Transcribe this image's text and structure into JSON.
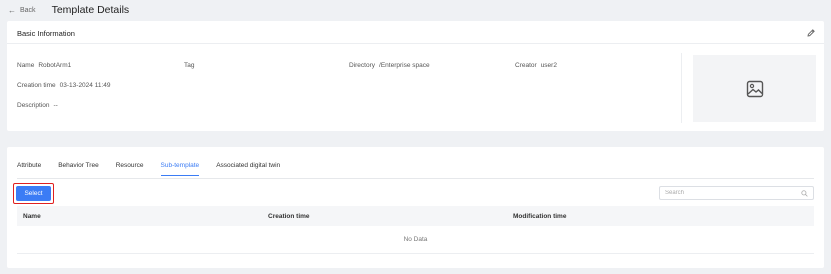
{
  "header": {
    "back_label": "Back",
    "title": "Template Details"
  },
  "basic": {
    "title": "Basic Information",
    "fields": {
      "name": {
        "label": "Name",
        "value": "RobotArm1"
      },
      "tag": {
        "label": "Tag",
        "value": ""
      },
      "directory": {
        "label": "Directory",
        "value": "/Enterprise space"
      },
      "creator": {
        "label": "Creator",
        "value": "user2"
      },
      "creation_time": {
        "label": "Creation time",
        "value": "03-13-2024 11:49"
      },
      "description": {
        "label": "Description",
        "value": "--"
      }
    }
  },
  "tabs": [
    {
      "label": "Attribute"
    },
    {
      "label": "Behavior Tree"
    },
    {
      "label": "Resource"
    },
    {
      "label": "Sub-template"
    },
    {
      "label": "Associated digital twin"
    }
  ],
  "active_tab": "Sub-template",
  "toolbar": {
    "select_label": "Select",
    "search_placeholder": "Search"
  },
  "table": {
    "columns": [
      "Name",
      "Creation time",
      "Modification time"
    ],
    "empty_text": "No Data"
  },
  "colors": {
    "accent": "#3b7cf5",
    "highlight": "#e02020"
  }
}
